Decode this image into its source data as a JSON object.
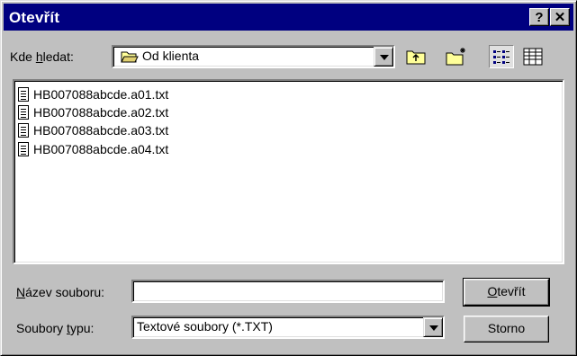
{
  "window": {
    "title": "Otevřít",
    "help_label": "?",
    "close_label": "✕"
  },
  "lookin": {
    "label_pre": "Kde ",
    "label_key": "h",
    "label_post": "ledat:",
    "value": "Od klienta",
    "folder_icon": "folder-open-icon"
  },
  "toolbar": {
    "up_icon": "up-folder-icon",
    "new_folder_icon": "new-folder-icon",
    "list_icon": "list-view-icon",
    "details_icon": "details-view-icon"
  },
  "files": [
    {
      "name": "HB007088abcde.a01.txt",
      "icon": "text-file-icon"
    },
    {
      "name": "HB007088abcde.a02.txt",
      "icon": "text-file-icon"
    },
    {
      "name": "HB007088abcde.a03.txt",
      "icon": "text-file-icon"
    },
    {
      "name": "HB007088abcde.a04.txt",
      "icon": "text-file-icon"
    }
  ],
  "filename": {
    "label_key": "N",
    "label_post": "ázev souboru:",
    "value": ""
  },
  "filetype": {
    "label_pre": "Soubory ",
    "label_key": "t",
    "label_post": "ypu:",
    "value": "Textové soubory (*.TXT)"
  },
  "buttons": {
    "open_key": "O",
    "open_rest": "tevřít",
    "cancel": "Storno"
  }
}
